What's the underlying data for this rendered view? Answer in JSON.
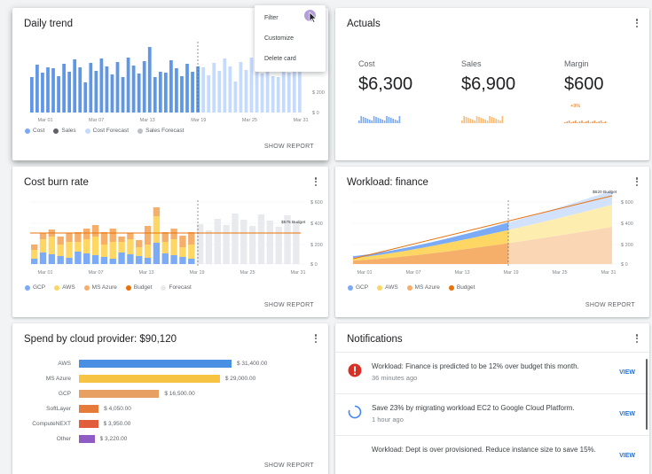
{
  "menu": {
    "items": [
      "Filter",
      "Customize",
      "Delete card"
    ]
  },
  "daily_trend": {
    "title": "Daily trend",
    "y_ticks": [
      "$ 200",
      "$ 0"
    ],
    "x_ticks": [
      "Mar 01",
      "Mar 07",
      "Mar 13",
      "Mar 19",
      "Mar 25",
      "Mar 31"
    ],
    "legend": [
      {
        "label": "Cost",
        "color": "#7baaf7"
      },
      {
        "label": "Sales",
        "color": "#5f6368"
      },
      {
        "label": "Cost Forecast",
        "color": "#c6dafc"
      },
      {
        "label": "Sales Forecast",
        "color": "#bdc1c6"
      }
    ],
    "show_report": "SHOW REPORT"
  },
  "actuals": {
    "title": "Actuals",
    "metrics": [
      {
        "label": "Cost",
        "value": "$6,300",
        "delta": "",
        "color": "#7baaf7"
      },
      {
        "label": "Sales",
        "value": "$6,900",
        "delta": "",
        "color": "#fbbc78"
      },
      {
        "label": "Margin",
        "value": "$600",
        "delta": "+9%",
        "color": "#f29d5a"
      }
    ]
  },
  "burn_rate": {
    "title": "Cost burn rate",
    "y_ticks": [
      "$ 600",
      "$ 400",
      "$ 200",
      "$ 0"
    ],
    "budget_label": "$575 Budget",
    "x_ticks": [
      "Mar 01",
      "Mar 07",
      "Mar 13",
      "Mar 19",
      "Mar 25",
      "Mar 31"
    ],
    "legend": [
      {
        "label": "GCP",
        "color": "#7baaf7"
      },
      {
        "label": "AWS",
        "color": "#fdd663"
      },
      {
        "label": "MS Azure",
        "color": "#f6ae6b"
      },
      {
        "label": "Budget",
        "color": "#e8710a"
      },
      {
        "label": "Forecast",
        "color": "#e8eaed"
      }
    ],
    "show_report": "SHOW REPORT"
  },
  "workload": {
    "title": "Workload: finance",
    "budget_label": "$620 Budget",
    "y_ticks": [
      "$ 600",
      "$ 400",
      "$ 200",
      "$ 0"
    ],
    "x_ticks": [
      "Mar 01",
      "Mar 07",
      "Mar 13",
      "Mar 19",
      "Mar 25",
      "Mar 31"
    ],
    "legend": [
      {
        "label": "GCP",
        "color": "#7baaf7"
      },
      {
        "label": "AWS",
        "color": "#fdd663"
      },
      {
        "label": "MS Azure",
        "color": "#f6ae6b"
      },
      {
        "label": "Budget",
        "color": "#e8710a"
      }
    ],
    "show_report": "SHOW REPORT"
  },
  "spend": {
    "title": "Spend by cloud provider: $90,120",
    "show_report": "SHOW REPORT"
  },
  "chart_data": {
    "type": "bar",
    "title": "Spend by cloud provider: $90,120",
    "categories": [
      "AWS",
      "MS Azure",
      "GCP",
      "SoftLayer",
      "ComputeNEXT",
      "Other"
    ],
    "values": [
      31400,
      29000,
      16500,
      4050,
      3950,
      3220
    ],
    "value_labels": [
      "$ 31,400.00",
      "$ 29,000.00",
      "$ 16,500.00",
      "$ 4,050.00",
      "$ 3,950.00",
      "$ 3,220.00"
    ],
    "colors": [
      "#4a90e2",
      "#f6c343",
      "#e8a062",
      "#e67a3a",
      "#e25d3c",
      "#8e5cc3"
    ]
  },
  "notifications": {
    "title": "Notifications",
    "items": [
      {
        "text": "Workload: Finance is predicted to be 12% over budget this month.",
        "time": "36 minutes ago",
        "action": "VIEW",
        "icon": "error-icon"
      },
      {
        "text": "Save 23% by migrating workload EC2 to Google Cloud Platform.",
        "time": "1 hour ago",
        "action": "VIEW",
        "icon": "loading-icon"
      },
      {
        "text": "Workload: Dept is over provisioned. Reduce instance size to save 15%.",
        "time": "",
        "action": "VIEW",
        "icon": ""
      }
    ]
  }
}
